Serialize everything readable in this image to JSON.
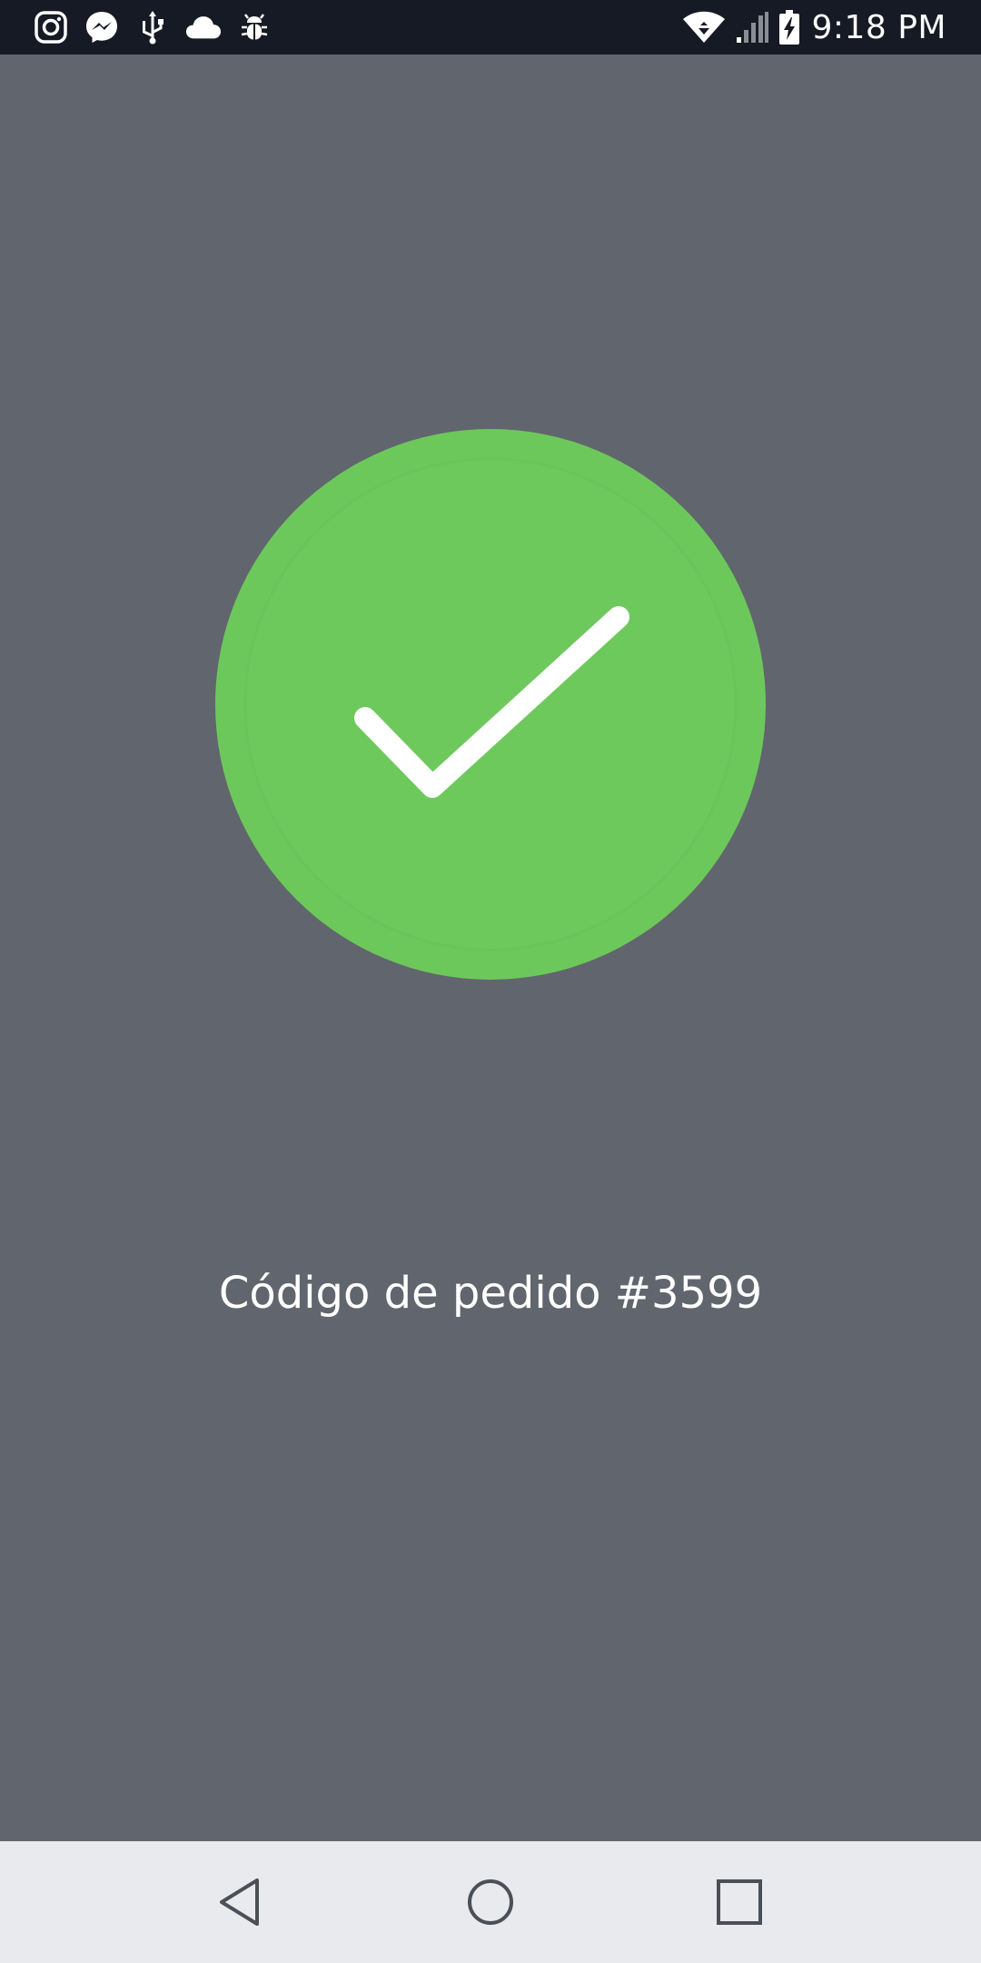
{
  "status_bar": {
    "time": "9:18 PM",
    "left_icons": [
      "instagram-icon",
      "messenger-icon",
      "usb-icon",
      "cloud-icon",
      "bug-icon"
    ],
    "right_icons": [
      "wifi-icon",
      "signal-icon",
      "battery-charging-icon"
    ]
  },
  "main": {
    "order_code": "Código de pedido #3599",
    "success_color": "#6dc85b",
    "background_color": "#61656d"
  },
  "nav_bar": {
    "buttons": [
      "back-icon",
      "home-icon",
      "recents-icon"
    ]
  }
}
